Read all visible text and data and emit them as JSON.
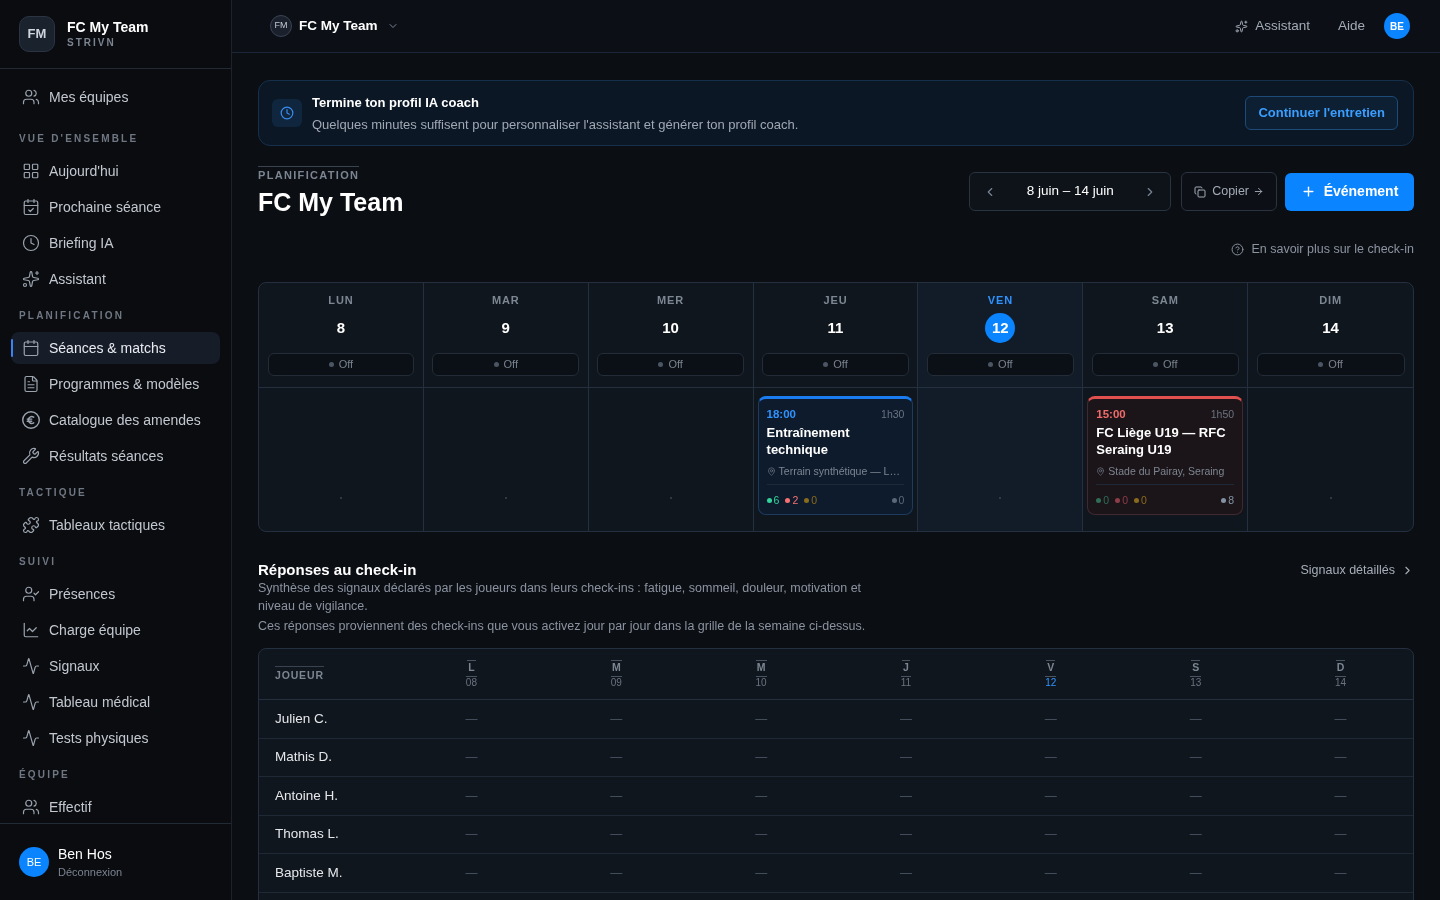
{
  "sidebar": {
    "brand": {
      "initials": "FM",
      "name": "FC My Team",
      "subtitle": "STRIVN"
    },
    "top_items": [
      {
        "label": "Mes équipes",
        "selected": false
      }
    ],
    "sections": [
      {
        "title": "VUE D'ENSEMBLE",
        "items": [
          {
            "label": "Aujourd'hui",
            "selected": false
          },
          {
            "label": "Prochaine séance",
            "selected": false
          },
          {
            "label": "Briefing IA",
            "selected": false
          },
          {
            "label": "Assistant",
            "selected": false
          }
        ]
      },
      {
        "title": "PLANIFICATION",
        "items": [
          {
            "label": "Séances & matchs",
            "selected": true
          },
          {
            "label": "Programmes & modèles",
            "selected": false
          },
          {
            "label": "Catalogue des amendes",
            "selected": false
          },
          {
            "label": "Résultats séances",
            "selected": false
          }
        ]
      },
      {
        "title": "TACTIQUE",
        "items": [
          {
            "label": "Tableaux tactiques",
            "selected": false
          }
        ]
      },
      {
        "title": "SUIVI",
        "items": [
          {
            "label": "Présences",
            "selected": false
          },
          {
            "label": "Charge équipe",
            "selected": false
          },
          {
            "label": "Signaux",
            "selected": false
          },
          {
            "label": "Tableau médical",
            "selected": false
          },
          {
            "label": "Tests physiques",
            "selected": false
          }
        ]
      },
      {
        "title": "ÉQUIPE",
        "items": [
          {
            "label": "Effectif",
            "selected": false
          }
        ]
      }
    ],
    "user": {
      "initials": "BE",
      "name": "Ben Hos",
      "action": "Déconnexion"
    }
  },
  "topbar": {
    "team": {
      "initials": "FM",
      "name": "FC My Team"
    },
    "assistant": "Assistant",
    "help": "Aide",
    "avatar": "BE"
  },
  "banner": {
    "title": "Termine ton profil IA coach",
    "text": "Quelques minutes suffisent pour personnaliser l'assistant et générer ton profil coach.",
    "button": "Continuer l'entretien"
  },
  "page_header": {
    "eyebrow": "PLANIFICATION",
    "title": "FC My Team",
    "week_range": "8 juin – 14 juin",
    "copy_button": "Copier",
    "new_event_button": "Événement",
    "checkin_help": "En savoir plus sur le check-in"
  },
  "week": {
    "days": [
      {
        "label": "LUN",
        "date": "8",
        "today": false,
        "checkin": "Off"
      },
      {
        "label": "MAR",
        "date": "9",
        "today": false,
        "checkin": "Off"
      },
      {
        "label": "MER",
        "date": "10",
        "today": false,
        "checkin": "Off"
      },
      {
        "label": "JEU",
        "date": "11",
        "today": false,
        "checkin": "Off",
        "events": [
          {
            "kind": "training",
            "time": "18:00",
            "duration": "1h30",
            "title": "Entraînement technique",
            "location": "Terrain synthétique — L…",
            "counts": [
              {
                "value": "6",
                "color": "#34d399"
              },
              {
                "value": "2",
                "color": "#f87171"
              },
              {
                "value": "0",
                "color": "#8a6a1c"
              }
            ],
            "pending": {
              "value": "0",
              "color": "#5b687a"
            }
          }
        ]
      },
      {
        "label": "VEN",
        "date": "12",
        "today": true,
        "checkin": "Off"
      },
      {
        "label": "SAM",
        "date": "13",
        "today": false,
        "checkin": "Off",
        "events": [
          {
            "kind": "match",
            "time": "15:00",
            "duration": "1h50",
            "title": "FC Liège U19 — RFC Seraing U19",
            "location": "Stade du Pairay, Seraing",
            "counts": [
              {
                "value": "0",
                "color": "#2f6d57"
              },
              {
                "value": "0",
                "color": "#8c3d48"
              },
              {
                "value": "0",
                "color": "#8a6a1c"
              }
            ],
            "pending": {
              "value": "8",
              "color": "#8391a3"
            }
          }
        ]
      },
      {
        "label": "DIM",
        "date": "14",
        "today": false,
        "checkin": "Off"
      }
    ]
  },
  "checkin": {
    "title": "Réponses au check-in",
    "description": [
      "Synthèse des signaux déclarés par les joueurs dans leurs check-ins : fatigue, sommeil, douleur, motivation et niveau de vigilance.",
      "Ces réponses proviennent des check-ins que vous activez jour par jour dans la grille de la semaine ci-dessus."
    ],
    "link": "Signaux détaillés",
    "table": {
      "player_column": "JOUEUR",
      "columns": [
        {
          "letter": "L",
          "date": "08",
          "today": false
        },
        {
          "letter": "M",
          "date": "09",
          "today": false
        },
        {
          "letter": "M",
          "date": "10",
          "today": false
        },
        {
          "letter": "J",
          "date": "11",
          "today": false
        },
        {
          "letter": "V",
          "date": "12",
          "today": true
        },
        {
          "letter": "S",
          "date": "13",
          "today": false
        },
        {
          "letter": "D",
          "date": "14",
          "today": false
        }
      ],
      "rows": [
        {
          "name": "Julien C.",
          "cells": [
            "—",
            "—",
            "—",
            "—",
            "—",
            "—",
            "—"
          ]
        },
        {
          "name": "Mathis D.",
          "cells": [
            "—",
            "—",
            "—",
            "—",
            "—",
            "—",
            "—"
          ]
        },
        {
          "name": "Antoine H.",
          "cells": [
            "—",
            "—",
            "—",
            "—",
            "—",
            "—",
            "—"
          ]
        },
        {
          "name": "Thomas L.",
          "cells": [
            "—",
            "—",
            "—",
            "—",
            "—",
            "—",
            "—"
          ]
        },
        {
          "name": "Baptiste M.",
          "cells": [
            "—",
            "—",
            "—",
            "—",
            "—",
            "—",
            "—"
          ]
        }
      ]
    }
  }
}
